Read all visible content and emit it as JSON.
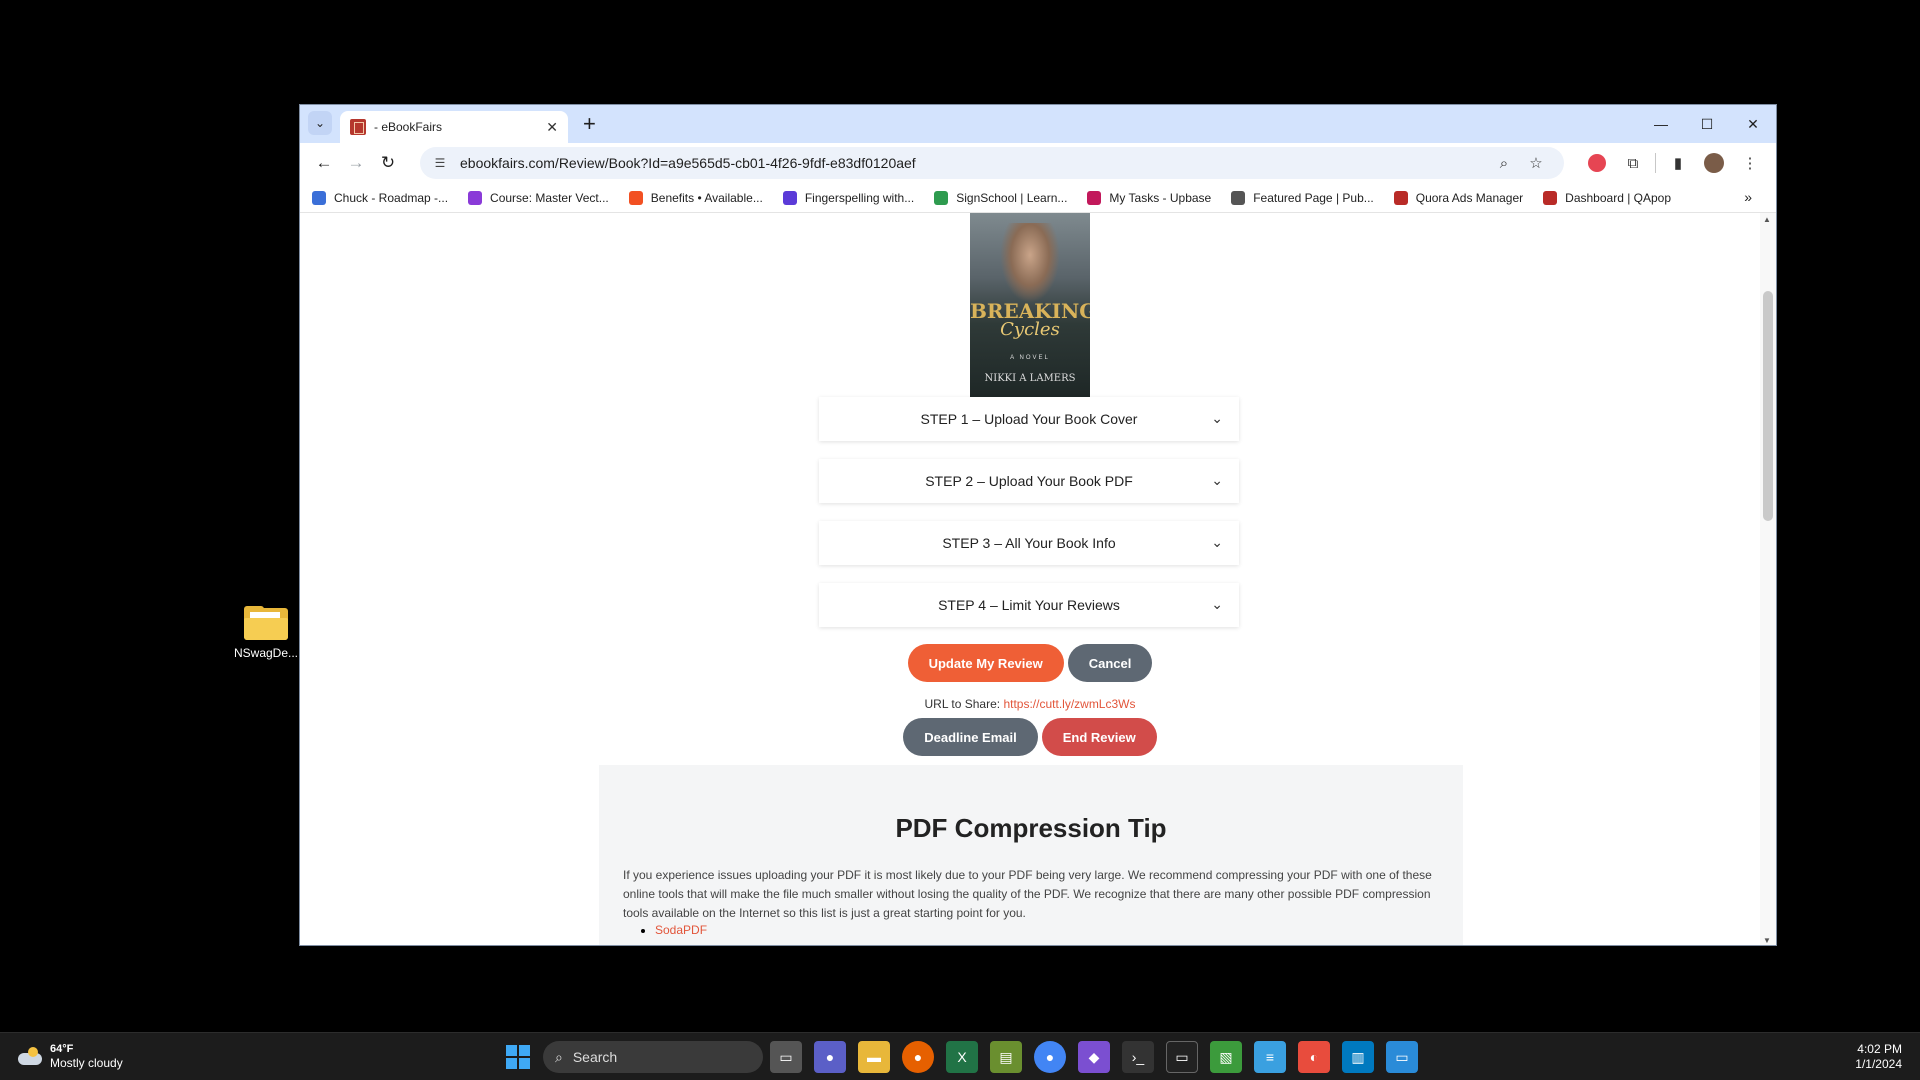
{
  "desktop": {
    "icon_label": "NSwagDe..."
  },
  "browser": {
    "tab_title": "- eBookFairs",
    "url": "ebookfairs.com/Review/Book?Id=a9e565d5-cb01-4f26-9fdf-e83df0120aef",
    "bookmarks": [
      {
        "label": "Chuck - Roadmap -...",
        "color": "#3b6fd8"
      },
      {
        "label": "Course: Master Vect...",
        "color": "#8a3ad8"
      },
      {
        "label": "Benefits • Available...",
        "color": "#f25022"
      },
      {
        "label": "Fingerspelling with...",
        "color": "#5b3bd8"
      },
      {
        "label": "SignSchool | Learn...",
        "color": "#2e9b4f"
      },
      {
        "label": "My Tasks - Upbase",
        "color": "#c2185b"
      },
      {
        "label": "Featured Page | Pub...",
        "color": "#555555"
      },
      {
        "label": "Quora Ads Manager",
        "color": "#b92b27"
      },
      {
        "label": "Dashboard | QApop",
        "color": "#b92b27"
      }
    ]
  },
  "page": {
    "cover": {
      "title_line1": "BREAKING",
      "title_line2": "Cycles",
      "subtitle": "A NOVEL",
      "author": "NIKKI A LAMERS"
    },
    "steps": [
      "STEP 1 – Upload Your Book Cover",
      "STEP 2 – Upload Your Book PDF",
      "STEP 3 – All Your Book Info",
      "STEP 4 – Limit Your Reviews"
    ],
    "update_label": "Update My Review",
    "cancel_label": "Cancel",
    "share_label": "URL to Share:",
    "share_url": "https://cutt.ly/zwmLc3Ws",
    "deadline_label": "Deadline Email",
    "end_label": "End Review",
    "tip_title": "PDF Compression Tip",
    "tip_text": "If you experience issues uploading your PDF it is most likely due to your PDF being very large. We recommend compressing your PDF with one of these online tools that will make the file much smaller without losing the quality of the PDF. We recognize that there are many other possible PDF compression tools available on the Internet so this list is just a great starting point for you.",
    "tip_link1": "SodaPDF"
  },
  "taskbar": {
    "temperature": "64°F",
    "condition": "Mostly cloudy",
    "search_placeholder": "Search",
    "time": "4:02 PM",
    "date": "1/1/2024"
  }
}
